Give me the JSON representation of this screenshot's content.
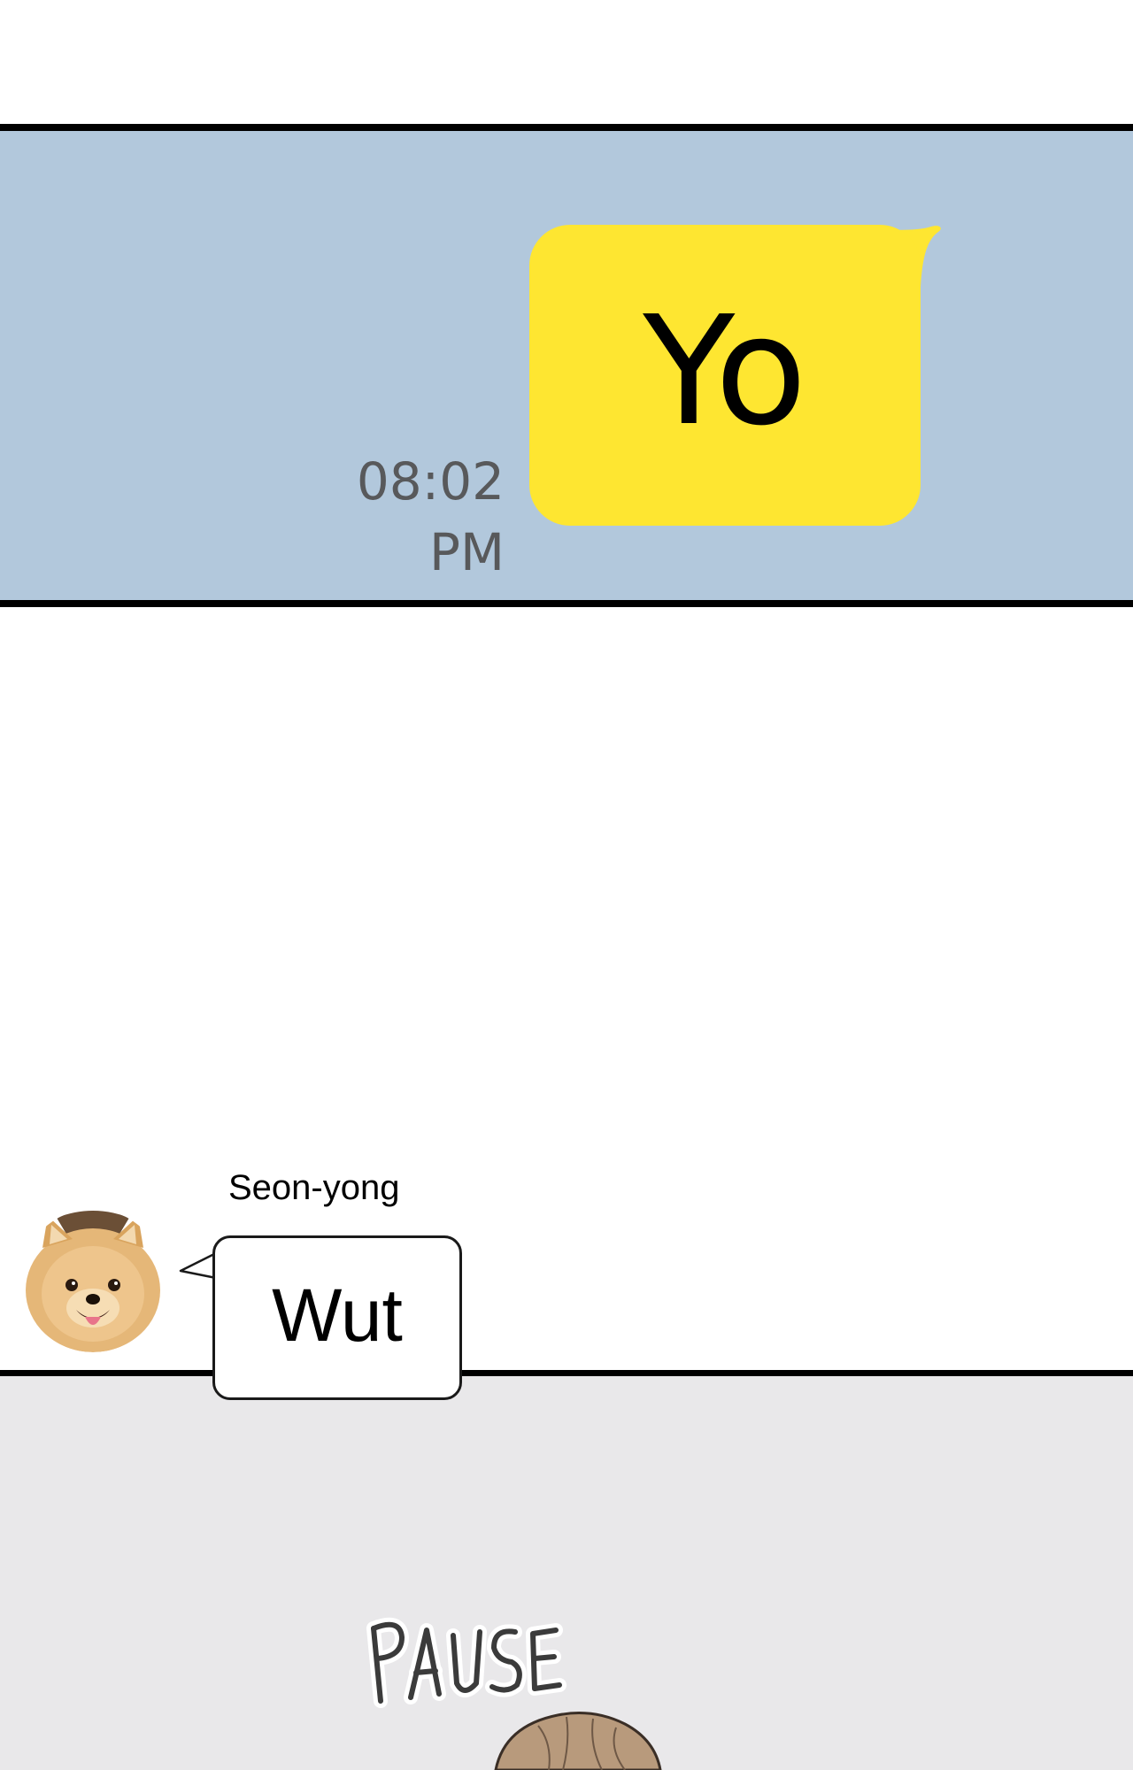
{
  "top_panel": {
    "sent_message": "Yo",
    "timestamp": "08:02 PM",
    "bubble_color": "#fee631",
    "background_color": "#b2c8dc"
  },
  "bottom_panel": {
    "sender_name": "Seon-yong",
    "received_message": "Wut",
    "avatar_icon": "pomeranian-dog-avatar",
    "background_color": "#e9e8ea"
  },
  "sound_effect": {
    "text": "PAUSE"
  }
}
